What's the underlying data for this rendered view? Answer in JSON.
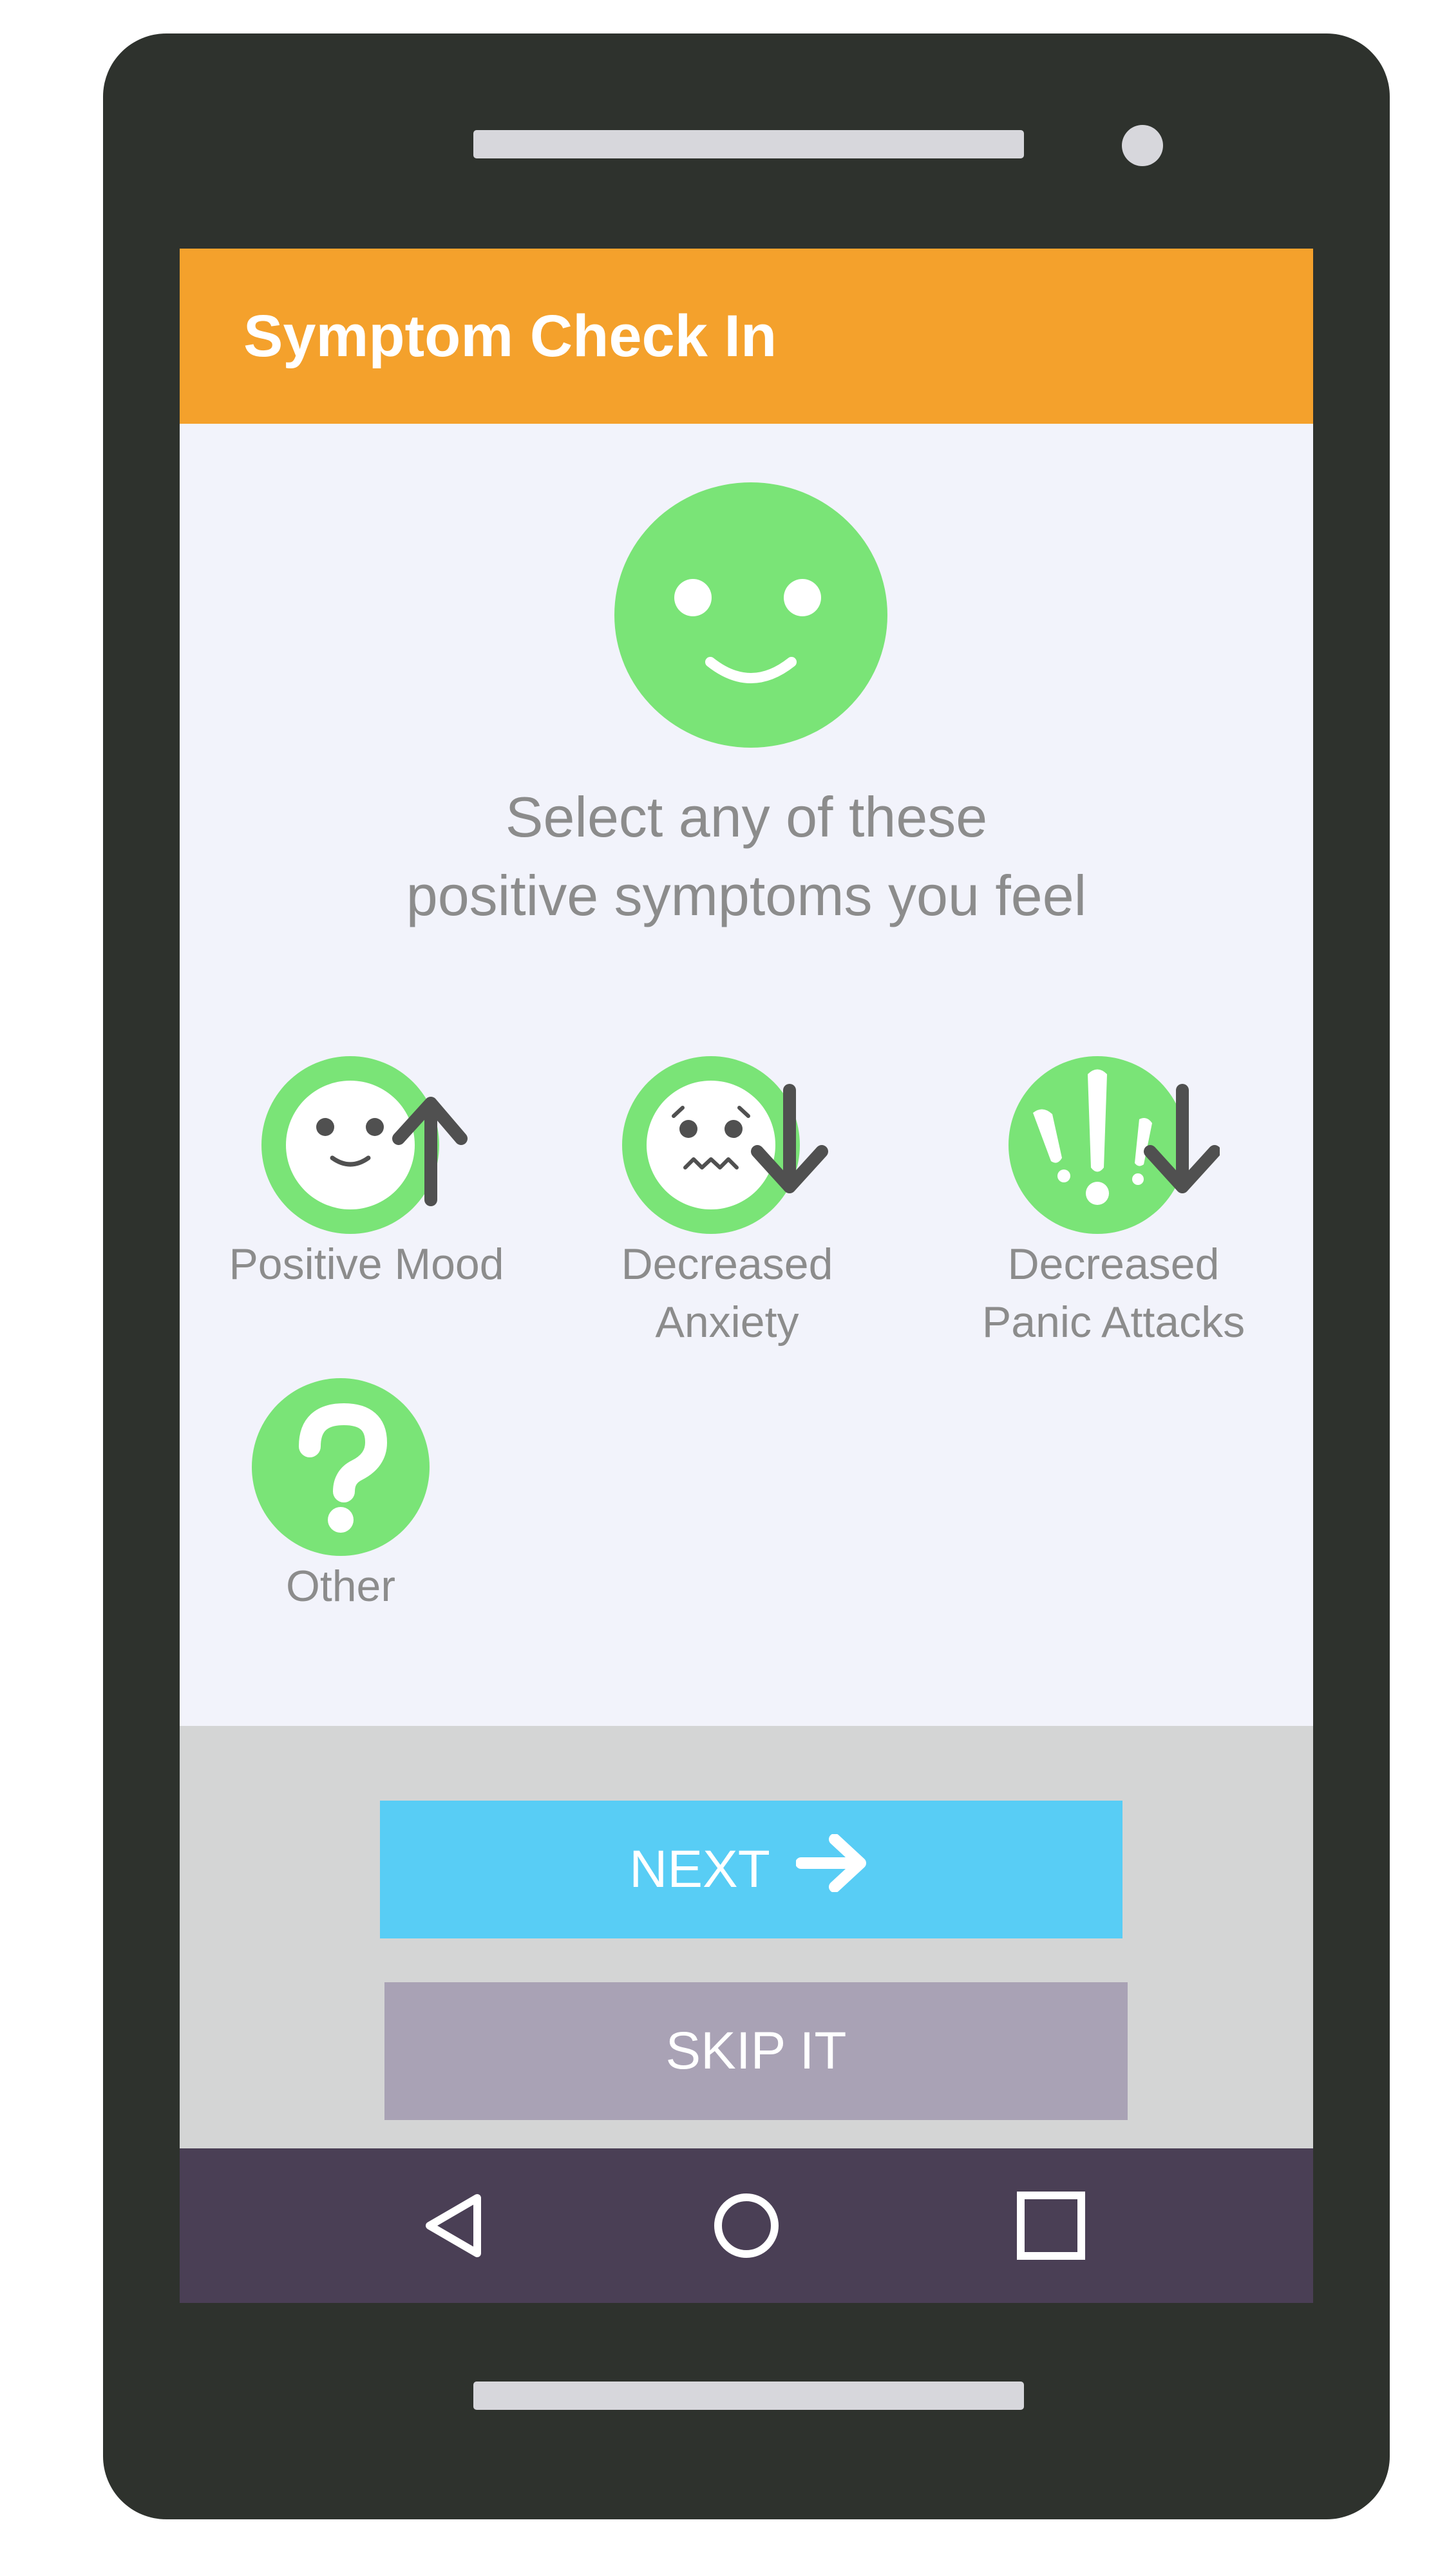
{
  "header": {
    "title": "Symptom Check In"
  },
  "prompt": {
    "line1": "Select any of these",
    "line2": "positive symptoms you feel"
  },
  "options": [
    {
      "line1": "Positive Mood",
      "line2": "",
      "icon": "smile-up-arrow-icon"
    },
    {
      "line1": "Decreased",
      "line2": "Anxiety",
      "icon": "anxious-face-down-arrow-icon"
    },
    {
      "line1": "Decreased",
      "line2": "Panic Attacks",
      "icon": "exclamation-down-arrow-icon"
    },
    {
      "line1": "Other",
      "line2": "",
      "icon": "question-icon"
    }
  ],
  "buttons": {
    "next_label": "NEXT",
    "skip_label": "SKIP IT"
  },
  "nav": {
    "back_icon": "back-triangle-icon",
    "home_icon": "home-circle-icon",
    "recents_icon": "recents-square-icon"
  },
  "colors": {
    "appbar": "#f4a12c",
    "accent_green": "#7ae477",
    "next_button": "#58cdf5",
    "skip_button": "#a9a2b5",
    "navbar": "#4a3f55",
    "phone_body": "#2e322d"
  }
}
